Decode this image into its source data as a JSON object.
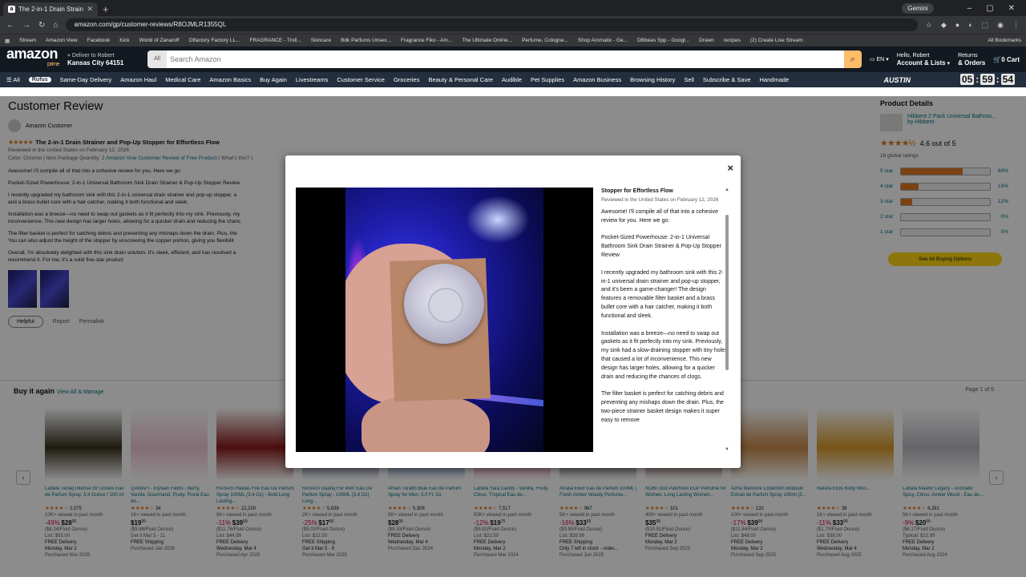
{
  "browser": {
    "tab_title": "The 2-in-1 Drain Strainer and P",
    "gemini": "Gemini",
    "url": "amazon.com/gp/customer-reviews/R8OJMLR1355QL",
    "bookmarks": [
      "Stream",
      "Amazon View",
      "Facebook",
      "Kick",
      "World of Zanaroff",
      "Olfactory Factory LL...",
      "FRAGRANCE - Troll...",
      "Skincare",
      "Bdk Parfums Unsex...",
      "Fragrance Fiko - Am...",
      "The Ultimate Online...",
      "Perfume, Cologne...",
      "Shop Aromatix - Ge...",
      "DBbeas Spp - Googl...",
      "Drawn",
      "recipes",
      "(2) Create Live Stream"
    ],
    "all_bookmarks": "All Bookmarks"
  },
  "header": {
    "logo": "amazon",
    "logo_sub": "prime",
    "deliver_to": "Deliver to Robert",
    "location": "Kansas City 64151",
    "search_category": "All",
    "search_placeholder": "Search Amazon",
    "language": "EN",
    "account_greeting": "Hello, Robert",
    "account_label": "Account & Lists",
    "returns_1": "Returns",
    "returns_2": "& Orders",
    "cart_count": "0",
    "cart_label": "Cart"
  },
  "nav": {
    "all": "All",
    "rufus": "Rufus",
    "items": [
      "Same-Day Delivery",
      "Amazon Haul",
      "Medical Care",
      "Amazon Basics",
      "Buy Again",
      "Livestreams",
      "Customer Service",
      "Groceries",
      "Beauty & Personal Care",
      "Audible",
      "Pet Supplies",
      "Amazon Business",
      "Browsing History",
      "Sell",
      "Subscribe & Save",
      "Handmade"
    ],
    "promo": "AUSTIN",
    "timer": [
      "05",
      "59",
      "54"
    ]
  },
  "review": {
    "page_title": "Customer Review",
    "reviewer": "Amazon Customer",
    "headline": "The 2-in-1 Drain Strainer and Pop-Up Stopper for Effortless Flow",
    "reviewed_in": "Reviewed in the United States on February 12, 2026",
    "variant": "Color: Chrome  |  Item Package Quantity: 2",
    "vine": "Amazon Vine Customer Review of Free Product",
    "vine_q": "( What's this? )",
    "p1": "Awesome! I'll compile all of that into a cohesive review for you. Here we go:",
    "p2": "Pocket-Sized Powerhouse: 2-in-1 Universal Bathroom Sink Drain Strainer & Pop-Up Stopper Review",
    "p3a": "I recently upgraded my bathroom sink with this 2-in-1 universal drain strainer and pop-up stopper, a",
    "p3b": "and a brass bullet core with a hair catcher, making it both functional and sleek.",
    "p4a": "Installation was a breeze—no need to swap out gaskets as it fit perfectly into my sink. Previously, my",
    "p4b": "inconvenience. This new design has larger holes, allowing for a quicker drain and reducing the chanc",
    "p5a": "The filter basket is perfect for catching debris and preventing any mishaps down the drain. Plus, the",
    "p5b": "You can also adjust the height of the stopper by unscrewing the copper portion, giving you flexibilit",
    "p6a": "Overall, I'm absolutely delighted with this sink drain solution. It's sleek, efficient, and has resolved a",
    "p6b": "recommend it. For me, it's a solid five-star product",
    "helpful": "Helpful",
    "report": "Report",
    "permalink": "Permalink"
  },
  "product_details": {
    "heading": "Product Details",
    "name": "Hibbent 2 Pack Universal Bathroo...",
    "by": "by Hibbent",
    "rating_text": "4.6 out of 5",
    "global_ratings": "18 global ratings",
    "rows": [
      {
        "label": "5 star",
        "pct": 69,
        "pct_text": "69%"
      },
      {
        "label": "4 star",
        "pct": 19,
        "pct_text": "19%"
      },
      {
        "label": "3 star",
        "pct": 12,
        "pct_text": "12%"
      },
      {
        "label": "2 star",
        "pct": 0,
        "pct_text": "0%"
      },
      {
        "label": "1 star",
        "pct": 0,
        "pct_text": "0%"
      }
    ],
    "buying_options": "See All Buying Options"
  },
  "buy_again": {
    "title": "Buy it again",
    "view_all": "View All & Manage",
    "page": "Page 1 of 5",
    "products": [
      {
        "title": "Lattafa Teriaq Intense for Unisex Eau de Parfum Spray, 3.4 Ounce / 100 ml",
        "rating": "2,075",
        "sub": "10K+ viewed in past month",
        "disc": "-49%",
        "price": "$28",
        "cents": "00",
        "extra": "($8.24/Fluid Ounce)",
        "list": "List: $55.00",
        "ship": "FREE Delivery",
        "date": "Monday, Mar 2",
        "purchased": "Purchased Nov 2025",
        "color": "#3a3220"
      },
      {
        "title": "QAWAFI - Elysian Fields - Berry, Vanilla, Gourmand, Fruity, Floral Eau de...",
        "rating": "34",
        "sub": "1K+ viewed in past month",
        "disc": "",
        "price": "$19",
        "cents": "99",
        "extra": "($5.88/Fluid Ounce)",
        "list": "Get it Mar 5 - 11",
        "ship": "FREE Shipping",
        "date": "",
        "purchased": "Purchased Jan 2026",
        "color": "#f1c8d6"
      },
      {
        "title": "RASASI Hawas Fire Eau De Parfum Spray 100ML (3.4 Oz) - Bold Long Lasting...",
        "rating": "22,200",
        "sub": "9K+ viewed in past month",
        "disc": "-11%",
        "price": "$39",
        "cents": "99",
        "extra": "($11.76/Fluid Ounce)",
        "list": "List: $44.99",
        "ship": "FREE Delivery",
        "date": "Wednesday, Mar 4",
        "purchased": "Purchased Apr 2025",
        "color": "#8a1a1a"
      },
      {
        "title": "RASASI Daarej For Men Eau De Parfum Spray - 100ML (3.4 Oz) Long...",
        "rating": "5,638",
        "sub": "2K+ viewed in past month",
        "disc": "-25%",
        "price": "$17",
        "cents": "00",
        "extra": "($5.02/Fluid Ounce)",
        "list": "List: $22.50",
        "ship": "FREE Shipping",
        "date": "Get it Mar 5 - 9",
        "purchased": "Purchased Mar 2025",
        "color": "#243e6b"
      },
      {
        "title": "Afnan Turathi Blue Eau de Parfum Spray for Men, 3.0 Fl. Oz",
        "rating": "5,308",
        "sub": "5K+ viewed in past month",
        "disc": "",
        "price": "$28",
        "cents": "00",
        "extra": "($9.33/Fluid Ounce)",
        "list": "",
        "ship": "FREE Delivery",
        "date": "Wednesday, Mar 4",
        "purchased": "Purchased Dec 2024",
        "color": "#2f5ea8"
      },
      {
        "title": "Lattafa Yara Candy - Vanilla, Fruity, Citrus, Tropical Eau de...",
        "rating": "7,517",
        "sub": "50K+ viewed in past month",
        "disc": "-12%",
        "price": "$19",
        "cents": "75",
        "extra": "($5.82/Fluid Ounce)",
        "list": "List: $22.50",
        "ship": "FREE Delivery",
        "date": "Monday, Mar 2",
        "purchased": "Purchased Mar 2024",
        "color": "#e0457b"
      },
      {
        "title": "Atralia Elixir Eau de Parfum 100ML | Fresh Amber Woody Perfume...",
        "rating": "967",
        "sub": "5K+ viewed in past month",
        "disc": "-16%",
        "price": "$33",
        "cents": "65",
        "extra": "($9.90/Fluid Ounce)",
        "list": "List: $39.99",
        "ship": "FREE Shipping",
        "date": "Only 7 left in stock - order...",
        "purchased": "Purchased Jun 2025",
        "color": "#1a1a1a"
      },
      {
        "title": "NOBI Oud Patchouli EDP Perfume for Women, Long Lasting Women...",
        "rating": "101",
        "sub": "400+ viewed in past month",
        "disc": "",
        "price": "$35",
        "cents": "99",
        "extra": "($10.51/Fluid Ounce)",
        "list": "",
        "ship": "FREE Delivery",
        "date": "Monday, Mar 2",
        "purchased": "Purchased Sep 2025",
        "color": "#6b2a1a"
      },
      {
        "title": "Azha Memoire Collection Bodouin Extrait de Parfum Spray 100ml (3...",
        "rating": "132",
        "sub": "100+ viewed in past month",
        "disc": "-17%",
        "price": "$39",
        "cents": "99",
        "extra": "($11.84/Fluid Ounce)",
        "list": "List: $48.00",
        "ship": "FREE Delivery",
        "date": "Monday, Mar 2",
        "purchased": "Purchased Sep 2025",
        "color": "#c98a4a"
      },
      {
        "title": "Natura Ekos Body Mist...",
        "rating": "38",
        "sub": "1K+ viewed in past month",
        "disc": "-11%",
        "price": "$33",
        "cents": "99",
        "extra": "($1.70/Fluid Ounce)",
        "list": "List: $38.00",
        "ship": "FREE Delivery",
        "date": "Wednesday, Mar 4",
        "purchased": "Purchased Aug 2025",
        "color": "#d99a2a"
      },
      {
        "title": "Lattafa Maahir Legacy - Aromatic Spicy, Citrus, Amber Wood - Eau de...",
        "rating": "4,281",
        "sub": "5K+ viewed in past month",
        "disc": "-9%",
        "price": "$20",
        "cents": "99",
        "extra": "($6.17/Fluid Ounce)",
        "list": "Typical: $22.99",
        "ship": "FREE Delivery",
        "date": "Monday, Mar 2",
        "purchased": "Purchased Aug 2024",
        "color": "#b8b8c0"
      }
    ]
  },
  "modal": {
    "close": "×",
    "title": "Stopper for Effortless Flow",
    "meta": "Reviewed in the United States on February 12, 2026",
    "paragraphs": [
      "Awesome! I'll compile all of that into a cohesive review for you. Here we go:",
      "Pocket-Sized Powerhouse: 2-in-1 Universal Bathroom Sink Drain Strainer & Pop-Up Stopper Review",
      "I recently upgraded my bathroom sink with this 2-in-1 universal drain strainer and pop-up stopper, and it's been a game-changer! The design features a removable filter basket and a brass bullet core with a hair catcher, making it both functional and sleek.",
      "Installation was a breeze—no need to swap out gaskets as it fit perfectly into my sink. Previously, my sink had a slow-draining stopper with tiny holes that caused a lot of inconvenience. This new design has larger holes, allowing for a quicker drain and reducing the chances of clogs.",
      "The filter basket is perfect for catching debris and preventing any mishaps down the drain. Plus, the two-piece strainer basket design makes it super easy to remove"
    ]
  }
}
